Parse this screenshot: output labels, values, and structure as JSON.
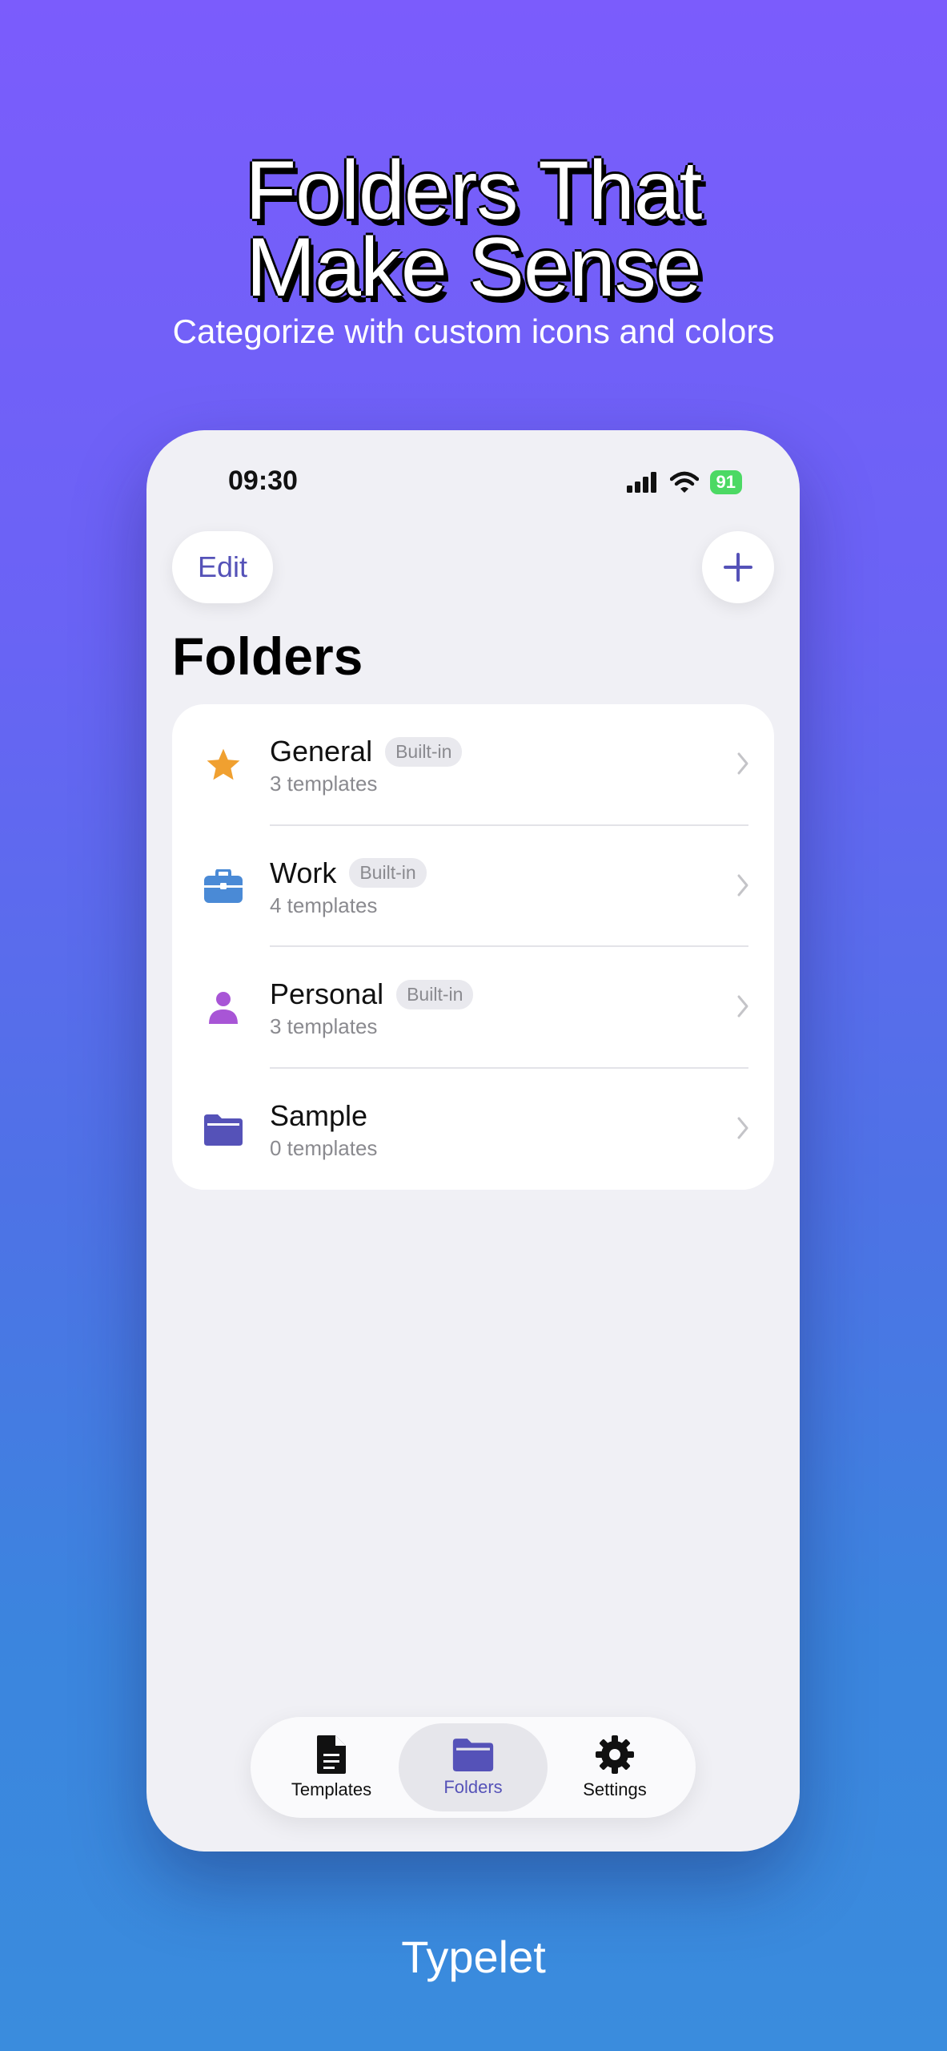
{
  "promo": {
    "headline_line1": "Folders That",
    "headline_line2": "Make Sense",
    "subheadline": "Categorize with custom icons and colors",
    "brand": "Typelet"
  },
  "status_bar": {
    "time": "09:30",
    "battery": "91"
  },
  "nav": {
    "edit_label": "Edit",
    "add_icon": "plus-icon"
  },
  "page_title": "Folders",
  "folders": [
    {
      "name": "General",
      "badge": "Built-in",
      "count": "3 templates",
      "icon": "star-icon",
      "color": "#f0a030"
    },
    {
      "name": "Work",
      "badge": "Built-in",
      "count": "4 templates",
      "icon": "briefcase-icon",
      "color": "#4a8ad6"
    },
    {
      "name": "Personal",
      "badge": "Built-in",
      "count": "3 templates",
      "icon": "person-icon",
      "color": "#a855d6"
    },
    {
      "name": "Sample",
      "badge": "",
      "count": "0 templates",
      "icon": "folder-icon",
      "color": "#5552b8"
    }
  ],
  "tabs": [
    {
      "label": "Templates",
      "icon": "document-icon",
      "active": false
    },
    {
      "label": "Folders",
      "icon": "folder-icon",
      "active": true
    },
    {
      "label": "Settings",
      "icon": "gear-icon",
      "active": false
    }
  ],
  "colors": {
    "accent": "#5552b8",
    "background": "#f0f0f5",
    "battery": "#4cd964"
  }
}
